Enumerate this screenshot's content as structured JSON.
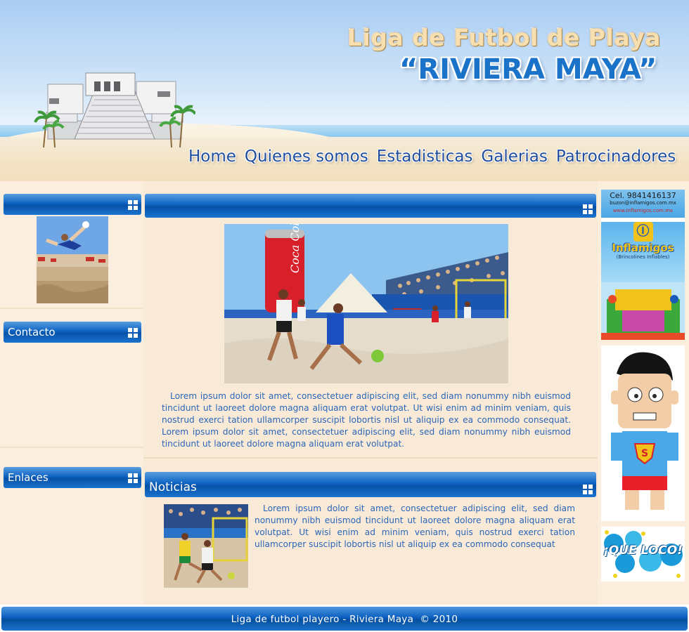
{
  "header": {
    "title_line1": "Liga de Futbol de Playa",
    "title_line2": "“RIVIERA MAYA”"
  },
  "nav": {
    "items": [
      "Home",
      "Quienes somos",
      "Estadisticas",
      "Galerias",
      "Patrocinadores"
    ]
  },
  "sidebar": {
    "panels": [
      {
        "title": ""
      },
      {
        "title": "Contacto"
      },
      {
        "title": "Enlaces"
      }
    ]
  },
  "main": {
    "featured_title": "",
    "featured_text": "Lorem ipsum dolor sit amet, consectetuer adipiscing elit, sed diam nonummy nibh euismod tincidunt ut laoreet dolore magna aliquam erat volutpat. Ut wisi enim ad minim veniam, quis nostrud exerci tation ullamcorper suscipit lobortis nisl ut aliquip ex ea commodo consequat. Lorem ipsum dolor sit amet, consectetuer adipiscing elit, sed diam nonummy nibh euismod tincidunt ut laoreet dolore magna aliquam erat volutpat.",
    "news_title": "Noticias",
    "news_text": "Lorem ipsum dolor sit amet, consectetuer adipiscing elit, sed diam nonummy nibh euismod tincidunt ut laoreet dolore magna aliquam erat volutpat. Ut wisi enim ad minim veniam, quis nostrud exerci tation ullamcorper suscipit lobortis nisl ut aliquip ex ea commodo consequat"
  },
  "sponsors": {
    "ad1": {
      "phone": "Cel. 9841416137",
      "email": "buzon@inflamigos.com.mx",
      "web": "www.inflamigos.com.mx",
      "brand": "Inflamigos",
      "tagline": "(Brincolines Inflables)"
    },
    "ad3": {
      "text": "¡QUE LOCO!"
    }
  },
  "footer": {
    "text": "Liga de futbol playero - Riviera Maya  © 2010"
  },
  "colors": {
    "nav_text": "#1f4d9c",
    "bar_blue": "#0b5fbf",
    "body_text": "#2b66b8",
    "panel_bg": "#f9ead8"
  }
}
